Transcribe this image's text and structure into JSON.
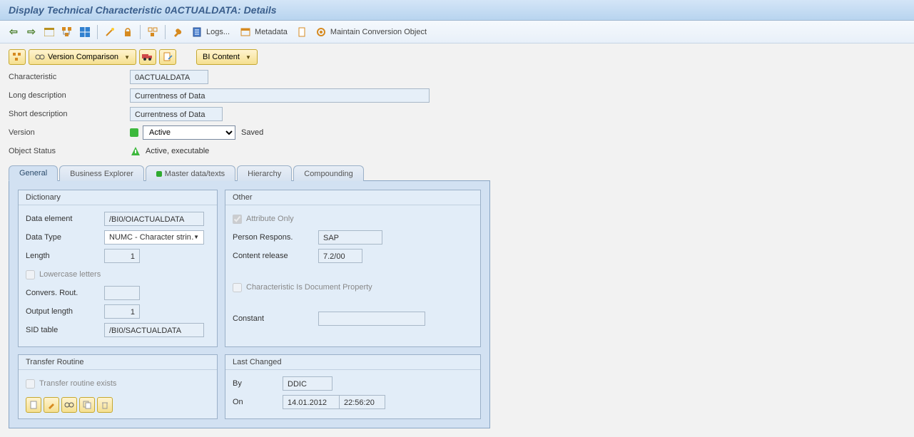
{
  "title": "Display Technical Characteristic 0ACTUALDATA: Details",
  "toolbar": {
    "logs": "Logs...",
    "metadata": "Metadata",
    "maintain": "Maintain Conversion Object"
  },
  "buttons": {
    "version_comparison": "Version Comparison",
    "bi_content": "BI Content"
  },
  "header": {
    "characteristic_label": "Characteristic",
    "characteristic_value": "0ACTUALDATA",
    "long_desc_label": "Long description",
    "long_desc_value": "Currentness of Data",
    "short_desc_label": "Short description",
    "short_desc_value": "Currentness of Data",
    "version_label": "Version",
    "version_value": "Active",
    "version_status": "Saved",
    "object_status_label": "Object Status",
    "object_status_value": "Active, executable"
  },
  "tabs": {
    "general": "General",
    "bex": "Business Explorer",
    "master": "Master data/texts",
    "hierarchy": "Hierarchy",
    "compounding": "Compounding"
  },
  "dictionary": {
    "title": "Dictionary",
    "data_element_label": "Data element",
    "data_element_value": "/BI0/OIACTUALDATA",
    "data_type_label": "Data Type",
    "data_type_value": "NUMC - Character strin…",
    "length_label": "Length",
    "length_value": "1",
    "lowercase_label": "Lowercase letters",
    "convers_label": "Convers. Rout.",
    "convers_value": "",
    "output_len_label": "Output length",
    "output_len_value": "1",
    "sid_label": "SID table",
    "sid_value": "/BI0/SACTUALDATA"
  },
  "other": {
    "title": "Other",
    "attr_only_label": "Attribute Only",
    "person_label": "Person Respons.",
    "person_value": "SAP",
    "release_label": "Content release",
    "release_value": "7.2/00",
    "doc_prop_label": "Characteristic Is Document Property",
    "constant_label": "Constant",
    "constant_value": ""
  },
  "transfer": {
    "title": "Transfer Routine",
    "exists_label": "Transfer routine exists"
  },
  "last_changed": {
    "title": "Last Changed",
    "by_label": "By",
    "by_value": "DDIC",
    "on_label": "On",
    "on_date": "14.01.2012",
    "on_time": "22:56:20"
  }
}
